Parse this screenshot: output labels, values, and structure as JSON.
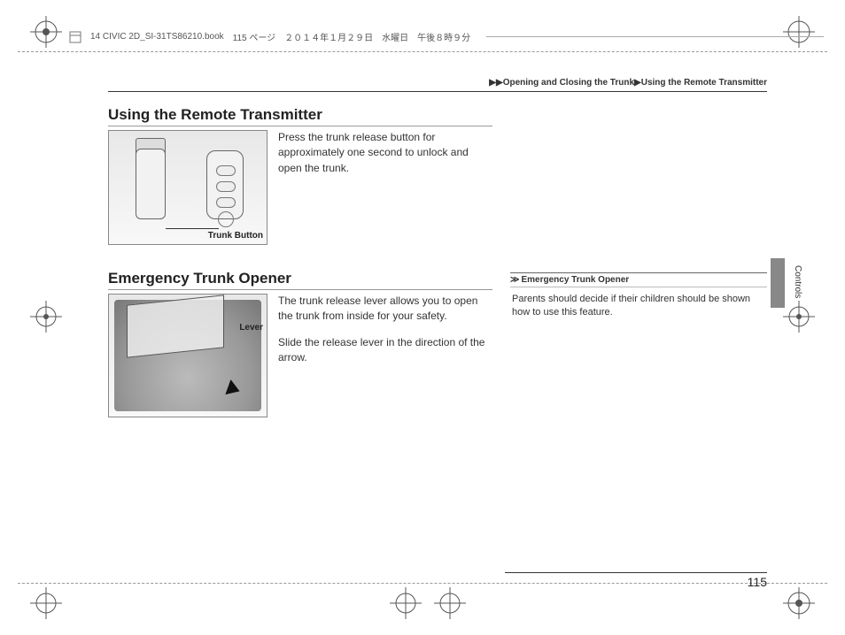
{
  "header": {
    "book_tag": "14 CIVIC 2D_SI-31TS86210.book",
    "page_tag": "115 ページ",
    "date_tag": "２０１４年１月２９日　水曜日　午後８時９分"
  },
  "breadcrumb": {
    "part1": "Opening and Closing the Trunk",
    "part2": "Using the Remote Transmitter"
  },
  "section1": {
    "title": "Using the Remote Transmitter",
    "body": "Press the trunk release button for approximately one second to unlock and open the trunk.",
    "callout": "Trunk Button"
  },
  "section2": {
    "title": "Emergency Trunk Opener",
    "body1": "The trunk release lever allows you to open the trunk from inside for your safety.",
    "body2": "Slide the release lever in the direction of the arrow.",
    "callout": "Lever"
  },
  "note": {
    "title": "Emergency Trunk Opener",
    "body": "Parents should decide if their children should be shown how to use this feature."
  },
  "side_tab": "Controls",
  "page_number": "115"
}
